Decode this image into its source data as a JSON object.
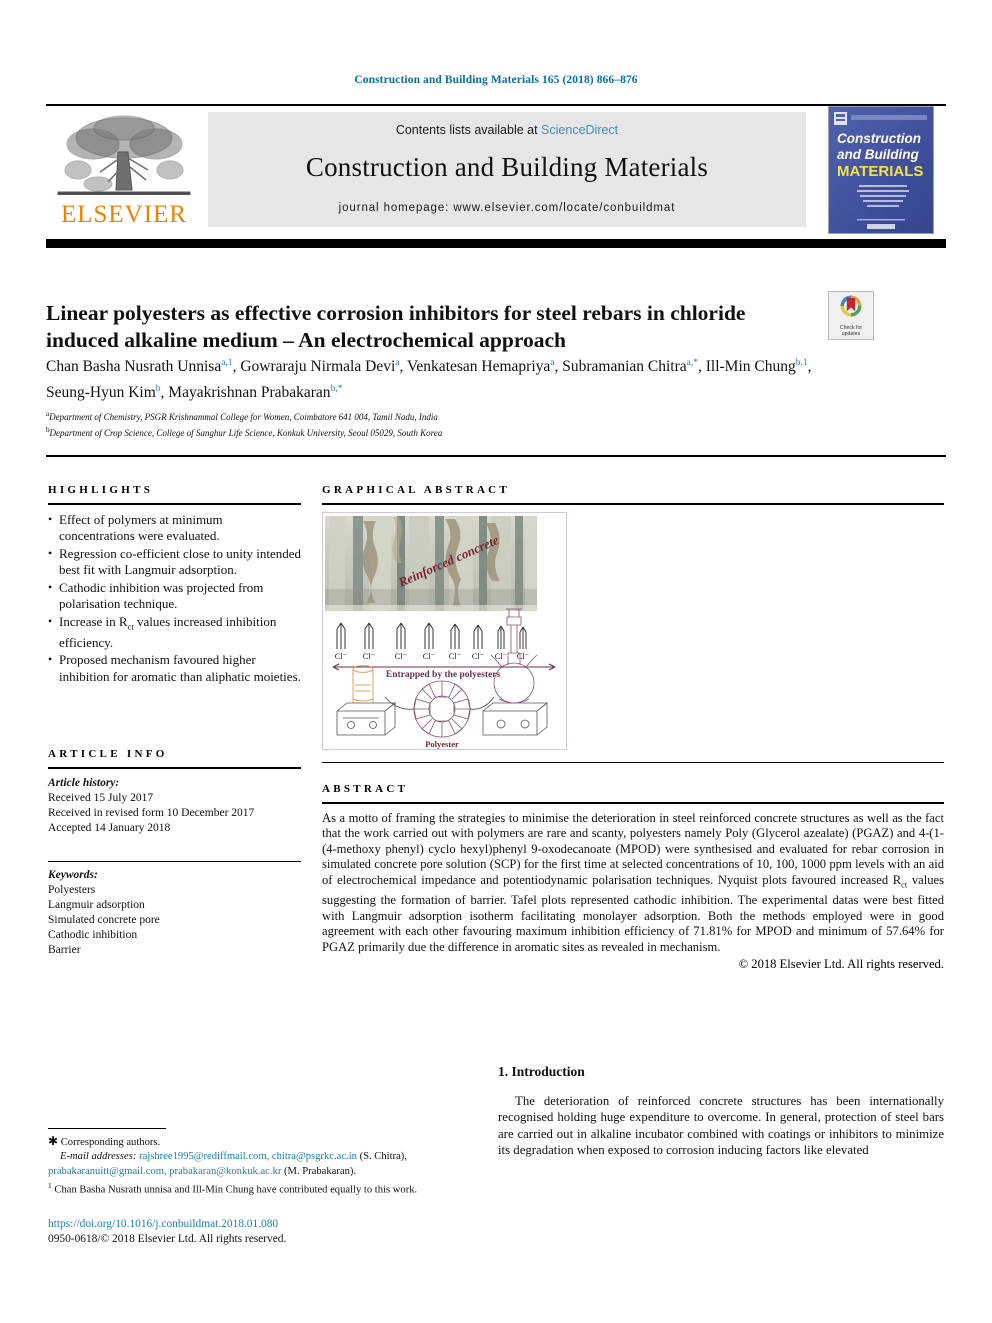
{
  "running_head": "Construction and Building Materials 165 (2018) 866–876",
  "masthead": {
    "contents_prefix": "Contents lists available at ",
    "sciencedirect": "ScienceDirect",
    "journal_title": "Construction and Building Materials",
    "homepage": "journal homepage: www.elsevier.com/locate/conbuildmat",
    "publisher": "ELSEVIER",
    "cover": {
      "line1": "Construction",
      "line2": "and Building",
      "line3": "MATERIALS",
      "blurb": "An international journal dedicated to the investigation and innovative use of materials in construction and repair",
      "footer": "Elsevier"
    }
  },
  "article": {
    "title": "Linear polyesters as effective corrosion inhibitors for steel rebars in chloride induced alkaline medium – An electrochemical approach",
    "authors_html": "Chan Basha Nusrath Unnisa<sup>a,1</sup>, Gowraraju Nirmala Devi<sup>a</sup>, Venkatesan Hemapriya<sup>a</sup>, Subramanian Chitra<sup>a,*</sup>, Ill-Min Chung<sup>b,1</sup>, Seung-Hyun Kim<sup>b</sup>, Mayakrishnan Prabakaran<sup>b,*</sup>",
    "affiliation_a": "Department of Chemistry, PSGR Krishnammal College for Women, Coimbatore 641 004, Tamil Nadu, India",
    "affiliation_b": "Department of Crop Science, College of Sanghur Life Science, Konkuk University, Seoul 05029, South Korea",
    "crossmark": {
      "line1": "Check for",
      "line2": "updates"
    }
  },
  "highlights": {
    "heading": "HIGHLIGHTS",
    "items": [
      "Effect of polymers at minimum concentrations were evaluated.",
      "Regression co-efficient close to unity intended best fit with Langmuir adsorption.",
      "Cathodic inhibition was projected from polarisation technique.",
      "Increase in R<sub class=\"small\">ct</sub> values increased inhibition efficiency.",
      "Proposed mechanism favoured higher inhibition for aromatic than aliphatic moieties."
    ]
  },
  "graphical_abstract": {
    "heading": "GRAPHICAL ABSTRACT",
    "labels": {
      "photo_caption": "Reinforced concrete",
      "ion": "Cl⁻",
      "arrow_caption": "Entrapped by the polyesters",
      "molecule": "Polyester"
    }
  },
  "article_info": {
    "heading": "ARTICLE INFO",
    "history_label": "Article history:",
    "history": [
      "Received 15 July 2017",
      "Received in revised form 10 December 2017",
      "Accepted 14 January 2018"
    ],
    "keywords_label": "Keywords:",
    "keywords": [
      "Polyesters",
      "Langmuir adsorption",
      "Simulated concrete pore",
      "Cathodic inhibition",
      "Barrier"
    ]
  },
  "abstract": {
    "heading": "ABSTRACT",
    "body_html": "As a motto of framing the strategies to minimise the deterioration in steel reinforced concrete structures as well as the fact that the work carried out with polymers are rare and scanty, polyesters namely Poly (Glycerol azealate) (PGAZ) and 4-(1-(4-methoxy phenyl) cyclo hexyl)phenyl 9-oxodecanoate (MPOD) were synthesised and evaluated for rebar corrosion in simulated concrete pore solution (SCP) for the first time at selected concentrations of 10, 100, 1000 ppm levels with an aid of electrochemical impedance and potentiodynamic polarisation techniques. Nyquist plots favoured increased R<sub class=\"small\">ct</sub> values suggesting the formation of barrier. Tafel plots represented cathodic inhibition. The experimental datas were best fitted with Langmuir adsorption isotherm facilitating monolayer adsorption. Both the methods employed were in good agreement with each other favouring maximum inhibition efficiency of 71.81% for MPOD and minimum of 57.64% for PGAZ primarily due the difference in aromatic sites as revealed in mechanism.",
    "copyright": "© 2018 Elsevier Ltd. All rights reserved."
  },
  "introduction": {
    "heading": "1. Introduction",
    "paragraph": "The deterioration of reinforced concrete structures has been internationally recognised holding huge expenditure to overcome. In general, protection of steel bars are carried out in alkaline incubator combined with coatings or inhibitors to minimize its degradation when exposed to corrosion inducing factors like elevated"
  },
  "footnotes": {
    "corresponding": "Corresponding authors.",
    "email_label": "E-mail addresses:",
    "emails_1": "rajshree1995@rediffmail.com, chitra@psgrkc.ac.in",
    "emails_1_attrib": "(S. Chitra),",
    "emails_2": "prabakaranuitt@gmail.com, prabakaran@konkuk.ac.kr",
    "emails_2_attrib": "(M. Prabakaran).",
    "equal_contrib": "Chan Basha Nusrath unnisa and Ill-Min Chung have contributed equally to this work."
  },
  "footer": {
    "doi": "https://doi.org/10.1016/j.conbuildmat.2018.01.080",
    "issn": "0950-0618/© 2018 Elsevier Ltd. All rights reserved."
  },
  "colors": {
    "link_blue": "#1b7fb8",
    "sciencedirect_blue": "#3a8fc4",
    "elsevier_orange": "#F08000",
    "cover_blue": "#4a5ba6",
    "cover_yellow": "#f2e34a",
    "ga_dark_red": "#7a2430",
    "ga_purple": "#6b3050"
  }
}
